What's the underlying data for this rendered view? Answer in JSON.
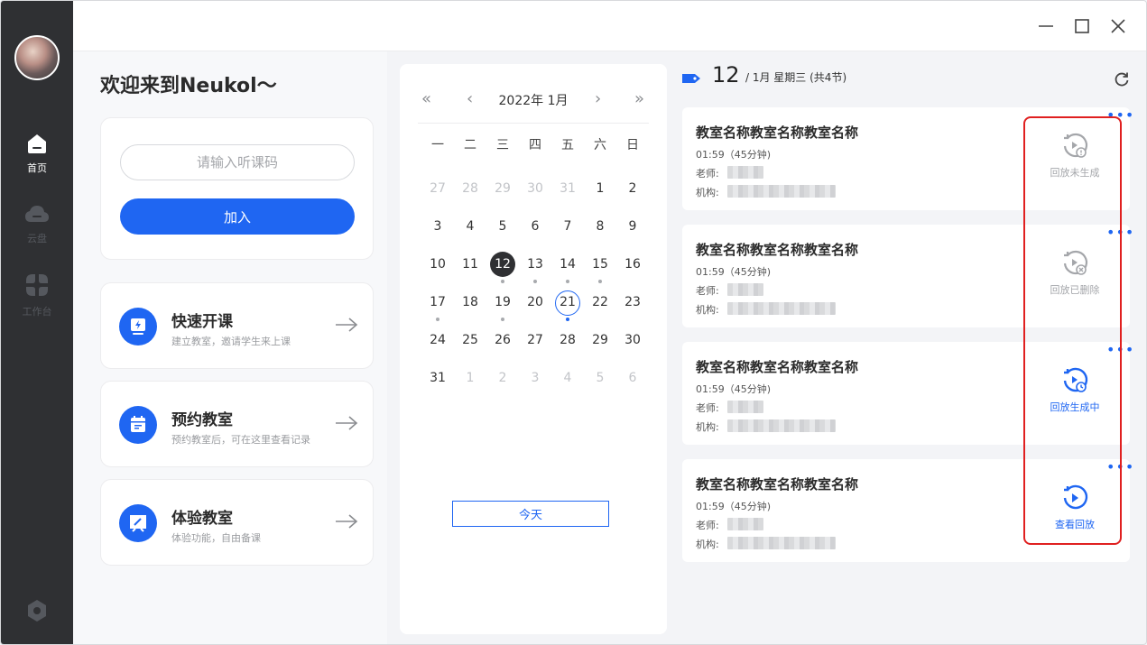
{
  "sidebar": {
    "items": [
      {
        "label": "首页",
        "icon": "home-icon",
        "active": true
      },
      {
        "label": "云盘",
        "icon": "cloud-icon",
        "active": false
      },
      {
        "label": "工作台",
        "icon": "workbench-icon",
        "active": false
      }
    ],
    "settings_icon": "settings-icon"
  },
  "left": {
    "welcome": "欢迎来到Neukol～",
    "join": {
      "placeholder": "请输入听课码",
      "button": "加入"
    },
    "actions": [
      {
        "title": "快速开课",
        "subtitle": "建立教室，邀请学生来上课",
        "icon": "lightning-screen-icon"
      },
      {
        "title": "预约教室",
        "subtitle": "预约教室后，可在这里查看记录",
        "icon": "calendar-icon"
      },
      {
        "title": "体验教室",
        "subtitle": "体验功能，自由备课",
        "icon": "board-icon"
      }
    ]
  },
  "calendar": {
    "month_label": "2022年 1月",
    "weekdays": [
      "一",
      "二",
      "三",
      "四",
      "五",
      "六",
      "日"
    ],
    "weeks": [
      [
        "27",
        "28",
        "29",
        "30",
        "31",
        "1",
        "2"
      ],
      [
        "3",
        "4",
        "5",
        "6",
        "7",
        "8",
        "9"
      ],
      [
        "10",
        "11",
        "12",
        "13",
        "14",
        "15",
        "16"
      ],
      [
        "17",
        "18",
        "19",
        "20",
        "21",
        "22",
        "23"
      ],
      [
        "24",
        "25",
        "26",
        "27",
        "28",
        "29",
        "30"
      ],
      [
        "31",
        "1",
        "2",
        "3",
        "4",
        "5",
        "6"
      ]
    ],
    "today_button": "今天",
    "selected": "12",
    "today": "21"
  },
  "schedule": {
    "day": "12",
    "info": "/ 1月   星期三 (共4节)",
    "courses": [
      {
        "name": "教室名称教室名称教室名称",
        "time": "01:59（45分钟)",
        "teacher_label": "老师:",
        "org_label": "机构:",
        "playback_label": "回放未生成",
        "playback_icon": "replay-warning-icon",
        "state": "grey"
      },
      {
        "name": "教室名称教室名称教室名称",
        "time": "01:59（45分钟)",
        "teacher_label": "老师:",
        "org_label": "机构:",
        "playback_label": "回放已删除",
        "playback_icon": "replay-deleted-icon",
        "state": "grey"
      },
      {
        "name": "教室名称教室名称教室名称",
        "time": "01:59（45分钟)",
        "teacher_label": "老师:",
        "org_label": "机构:",
        "playback_label": "回放生成中",
        "playback_icon": "replay-pending-icon",
        "state": "blue"
      },
      {
        "name": "教室名称教室名称教室名称",
        "time": "01:59（45分钟)",
        "teacher_label": "老师:",
        "org_label": "机构:",
        "playback_label": "查看回放",
        "playback_icon": "replay-play-icon",
        "state": "blue"
      }
    ]
  },
  "colors": {
    "accent": "#1f66f2",
    "sidebar": "#2f3033",
    "highlight": "#e02020"
  }
}
